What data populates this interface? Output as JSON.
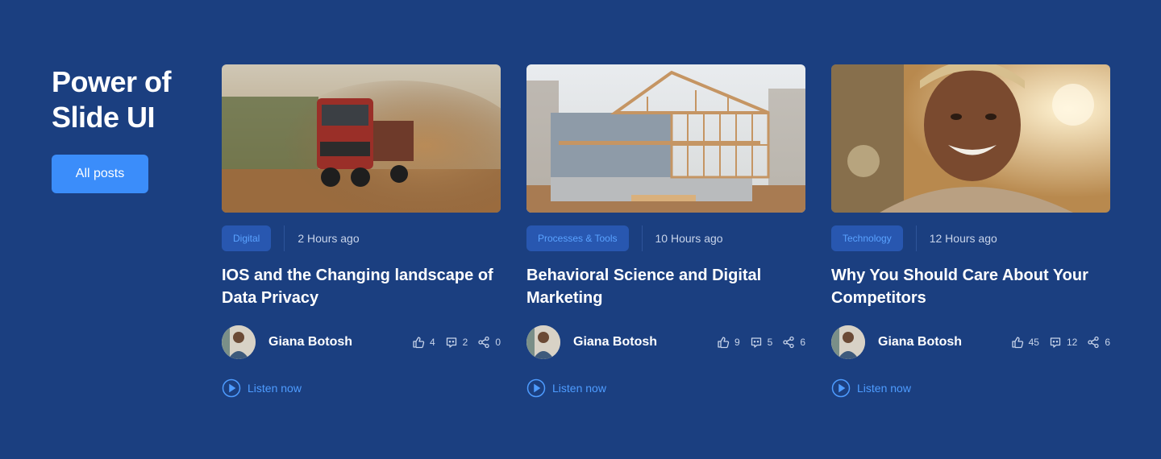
{
  "intro": {
    "title_line1": "Power of",
    "title_line2": "Slide UI",
    "button_label": "All posts"
  },
  "colors": {
    "background": "#1b3f80",
    "accent": "#3b8dfa",
    "tag_bg": "#2857b0",
    "tag_text": "#5aa2ff"
  },
  "icons": {
    "like": "thumbs-up-icon",
    "comment": "comment-icon",
    "share": "share-icon",
    "play": "play-circle-icon"
  },
  "cards": [
    {
      "tag": "Digital",
      "time": "2 Hours ago",
      "title": "IOS and the Changing landscape of Data Privacy",
      "author": "Giana Botosh",
      "likes": "4",
      "comments": "2",
      "shares": "0",
      "listen": "Listen now"
    },
    {
      "tag": "Processes & Tools",
      "time": "10 Hours ago",
      "title": "Behavioral Science and Digital Marketing",
      "author": "Giana Botosh",
      "likes": "9",
      "comments": "5",
      "shares": "6",
      "listen": "Listen now"
    },
    {
      "tag": "Technology",
      "time": "12 Hours ago",
      "title": "Why You Should Care About Your Competitors",
      "author": "Giana Botosh",
      "likes": "45",
      "comments": "12",
      "shares": "6",
      "listen": "Listen now"
    }
  ]
}
